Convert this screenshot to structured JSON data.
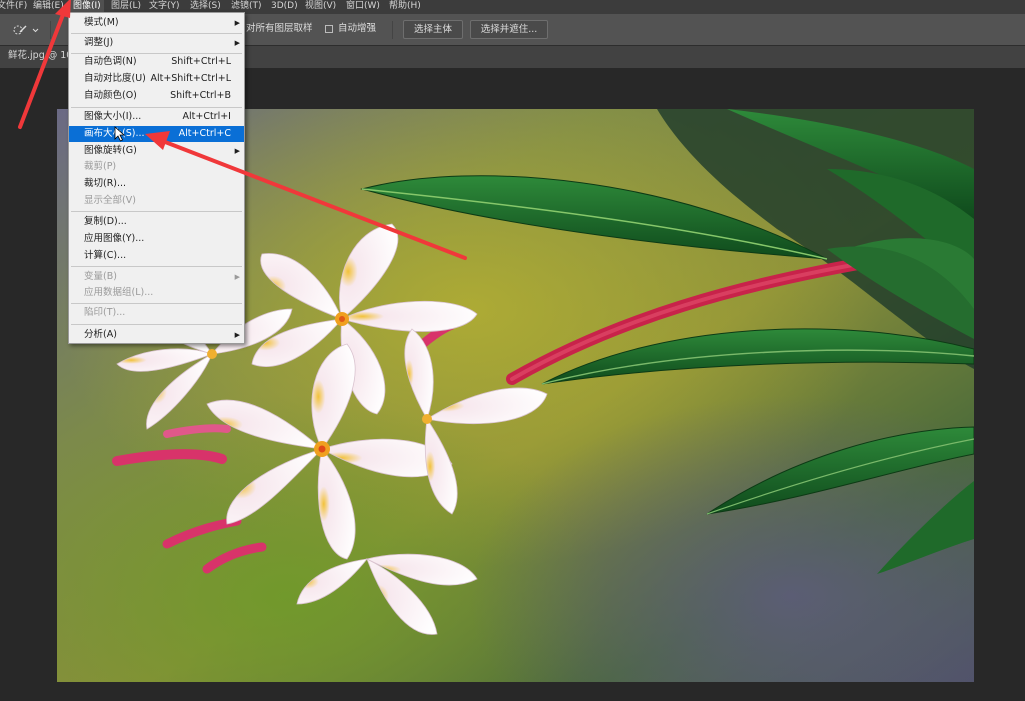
{
  "menubar": {
    "items": [
      {
        "label": "文件(F)"
      },
      {
        "label": "编辑(E)"
      },
      {
        "label": "图像(I)"
      },
      {
        "label": "图层(L)"
      },
      {
        "label": "文字(Y)"
      },
      {
        "label": "选择(S)"
      },
      {
        "label": "滤镜(T)"
      },
      {
        "label": "3D(D)"
      },
      {
        "label": "视图(V)"
      },
      {
        "label": "窗口(W)"
      },
      {
        "label": "帮助(H)"
      }
    ],
    "active_index": 2
  },
  "options_bar": {
    "sample_all_layers_label": "对所有图层取样",
    "auto_enhance_label": "自动增强",
    "select_subject_label": "选择主体",
    "select_and_mask_label": "选择并遮住..."
  },
  "document_tab": {
    "label": "鲜花.jpg @ 10"
  },
  "image_menu": {
    "items": [
      {
        "label": "模式(M)",
        "shortcut": "",
        "submenu": true,
        "disabled": false
      },
      {
        "separator": true
      },
      {
        "label": "调整(J)",
        "shortcut": "",
        "submenu": true,
        "disabled": false
      },
      {
        "separator": true
      },
      {
        "label": "自动色调(N)",
        "shortcut": "Shift+Ctrl+L",
        "submenu": false,
        "disabled": false
      },
      {
        "label": "自动对比度(U)",
        "shortcut": "Alt+Shift+Ctrl+L",
        "submenu": false,
        "disabled": false
      },
      {
        "label": "自动颜色(O)",
        "shortcut": "Shift+Ctrl+B",
        "submenu": false,
        "disabled": false
      },
      {
        "separator": true
      },
      {
        "label": "图像大小(I)...",
        "shortcut": "Alt+Ctrl+I",
        "submenu": false,
        "disabled": false
      },
      {
        "label": "画布大小(S)...",
        "shortcut": "Alt+Ctrl+C",
        "submenu": false,
        "disabled": false,
        "highlighted": true
      },
      {
        "label": "图像旋转(G)",
        "shortcut": "",
        "submenu": true,
        "disabled": false
      },
      {
        "label": "裁剪(P)",
        "shortcut": "",
        "submenu": false,
        "disabled": true
      },
      {
        "label": "裁切(R)...",
        "shortcut": "",
        "submenu": false,
        "disabled": false
      },
      {
        "label": "显示全部(V)",
        "shortcut": "",
        "submenu": false,
        "disabled": true
      },
      {
        "separator": true
      },
      {
        "label": "复制(D)...",
        "shortcut": "",
        "submenu": false,
        "disabled": false
      },
      {
        "label": "应用图像(Y)...",
        "shortcut": "",
        "submenu": false,
        "disabled": false
      },
      {
        "label": "计算(C)...",
        "shortcut": "",
        "submenu": false,
        "disabled": false
      },
      {
        "separator": true
      },
      {
        "label": "变量(B)",
        "shortcut": "",
        "submenu": true,
        "disabled": true
      },
      {
        "label": "应用数据组(L)...",
        "shortcut": "",
        "submenu": false,
        "disabled": true
      },
      {
        "separator": true
      },
      {
        "label": "陷印(T)...",
        "shortcut": "",
        "submenu": false,
        "disabled": true
      },
      {
        "separator": true
      },
      {
        "label": "分析(A)",
        "shortcut": "",
        "submenu": true,
        "disabled": false
      }
    ]
  },
  "colors": {
    "highlight": "#0a6fd6",
    "annotation_arrow": "#f0383a"
  }
}
